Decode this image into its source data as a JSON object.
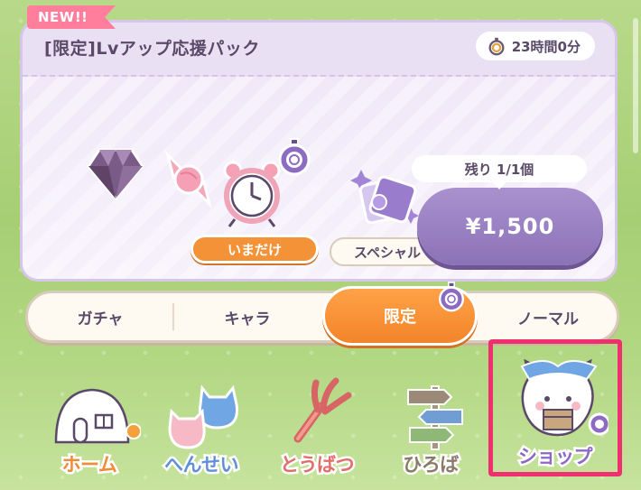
{
  "pack": {
    "new_label": "NEW!!",
    "title": "[限定]Lvアップ応援パック",
    "timer": "23時間0分",
    "badges": {
      "limited_now": "いまだけ",
      "special": "スペシャル"
    },
    "remaining": "残り 1/1個",
    "price": "¥1,500",
    "icons": [
      "diamond-icon",
      "candy-icon",
      "alarm-clock-icon",
      "stopwatch-icon",
      "ticket-pack-icon"
    ]
  },
  "tabs": [
    {
      "label": "ガチャ",
      "active": false
    },
    {
      "label": "キャラ",
      "active": false
    },
    {
      "label": "限定",
      "active": true
    },
    {
      "label": "ノーマル",
      "active": false
    }
  ],
  "nav": [
    {
      "label": "ホーム",
      "icon": "house-icon"
    },
    {
      "label": "へんせい",
      "icon": "characters-icon"
    },
    {
      "label": "とうばつ",
      "icon": "fork-weapon-icon"
    },
    {
      "label": "ひろば",
      "icon": "signpost-icon"
    },
    {
      "label": "ショップ",
      "icon": "shop-character-icon"
    }
  ],
  "colors": {
    "accent_orange": "#f49237",
    "price_purple": "#9a80c2",
    "highlight_pink": "#f0306e"
  }
}
